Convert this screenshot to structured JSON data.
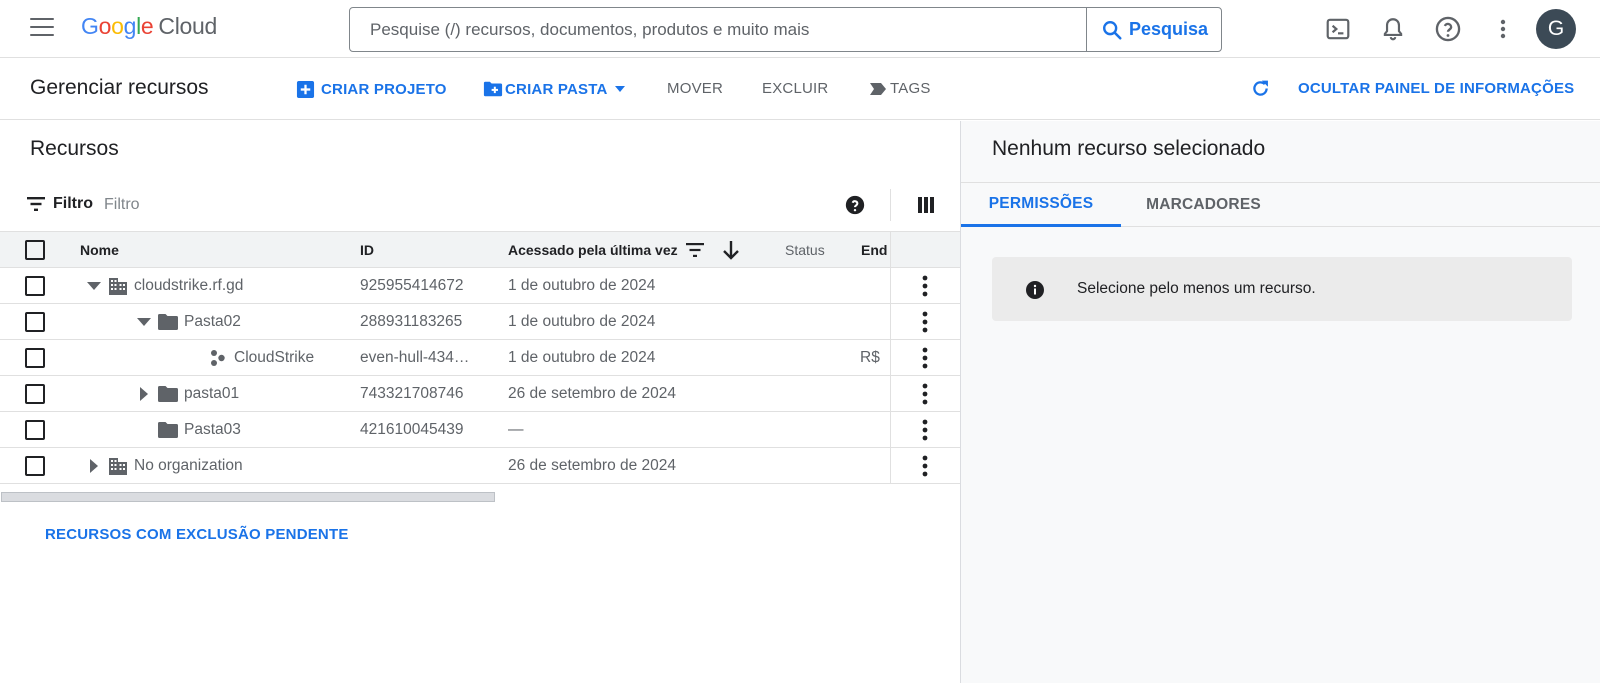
{
  "header": {
    "logo_google": "Google",
    "logo_cloud": "Cloud",
    "search_placeholder": "Pesquise (/) recursos, documentos, produtos e muito mais",
    "search_button": "Pesquisa",
    "avatar_initial": "G"
  },
  "toolbar": {
    "page_title": "Gerenciar recursos",
    "create_project": "CRIAR PROJETO",
    "create_folder": "CRIAR PASTA",
    "move": "MOVER",
    "delete": "EXCLUIR",
    "tags": "TAGS",
    "hide_info_panel": "OCULTAR PAINEL DE INFORMAÇÕES"
  },
  "resources": {
    "title": "Recursos",
    "filter_label": "Filtro",
    "filter_placeholder": "Filtro",
    "columns": {
      "name": "Nome",
      "id": "ID",
      "last_accessed": "Acessado pela última vez",
      "status": "Status",
      "end": "End"
    },
    "rows": [
      {
        "name": "cloudstrike.rf.gd",
        "id": "925955414672",
        "accessed": "1 de outubro de 2024",
        "end": "",
        "type": "organization",
        "expand": "expanded"
      },
      {
        "name": "Pasta02",
        "id": "288931183265",
        "accessed": "1 de outubro de 2024",
        "end": "",
        "type": "folder",
        "expand": "expanded"
      },
      {
        "name": "CloudStrike",
        "id": "even-hull-434…",
        "accessed": "1 de outubro de 2024",
        "end": "R$",
        "type": "project",
        "expand": "none"
      },
      {
        "name": "pasta01",
        "id": "743321708746",
        "accessed": "26 de setembro de 2024",
        "end": "",
        "type": "folder",
        "expand": "collapsed"
      },
      {
        "name": "Pasta03",
        "id": "421610045439",
        "accessed": "—",
        "end": "",
        "type": "folder",
        "expand": "none"
      },
      {
        "name": "No organization",
        "id": "",
        "accessed": "26 de setembro de 2024",
        "end": "",
        "type": "organization",
        "expand": "collapsed"
      }
    ],
    "pending_link": "RECURSOS COM EXCLUSÃO PENDENTE"
  },
  "info_panel": {
    "title": "Nenhum recurso selecionado",
    "tab_permissions": "PERMISSÕES",
    "tab_labels": "MARCADORES",
    "message": "Selecione pelo menos um recurso."
  },
  "colors": {
    "accent": "#1a73e8",
    "text_primary": "#202124",
    "text_secondary": "#5f6368",
    "avatar_bg": "#3c4a56"
  }
}
